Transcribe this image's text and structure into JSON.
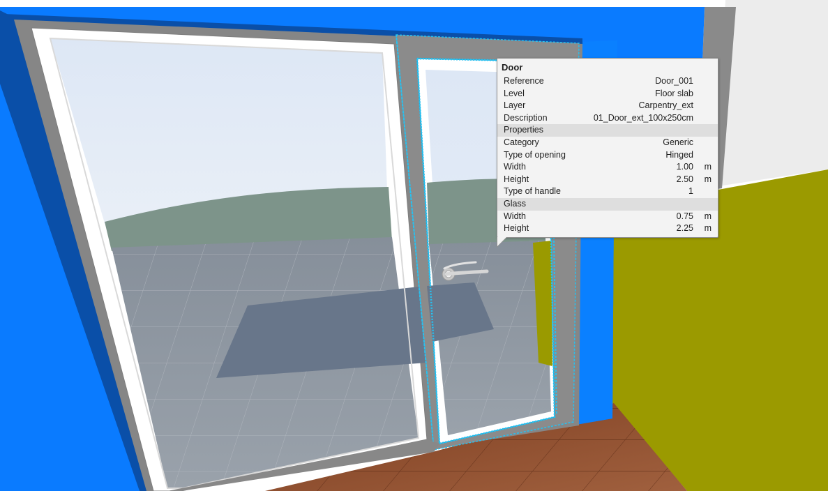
{
  "tooltip": {
    "title": "Door",
    "rows": [
      {
        "label": "Reference",
        "value": "Door_001",
        "unit": ""
      },
      {
        "label": "Level",
        "value": "Floor slab",
        "unit": ""
      },
      {
        "label": "Layer",
        "value": "Carpentry_ext",
        "unit": ""
      },
      {
        "label": "Description",
        "value": "01_Door_ext_100x250cm",
        "unit": ""
      }
    ],
    "sections": [
      {
        "title": "Properties",
        "rows": [
          {
            "label": "Category",
            "value": "Generic",
            "unit": ""
          },
          {
            "label": "Type of opening",
            "value": "Hinged",
            "unit": ""
          },
          {
            "label": "Width",
            "value": "1.00",
            "unit": "m"
          },
          {
            "label": "Height",
            "value": "2.50",
            "unit": "m"
          },
          {
            "label": "Type of handle",
            "value": "1",
            "unit": ""
          }
        ]
      },
      {
        "title": "Glass",
        "rows": [
          {
            "label": "Width",
            "value": "0.75",
            "unit": "m"
          },
          {
            "label": "Height",
            "value": "2.25",
            "unit": "m"
          }
        ]
      }
    ]
  },
  "colors": {
    "wall_blue": "#0a7bff",
    "wall_shadow": "#0a55b8",
    "frame_gray": "#868686",
    "side_wall_olive": "#9a9a00",
    "sky": "#e4ecf6",
    "hill": "#7d948a",
    "floor_tile": "#7f8a96",
    "wood_floor": "#8b4a2e",
    "selection_cyan": "#27c1f0"
  }
}
